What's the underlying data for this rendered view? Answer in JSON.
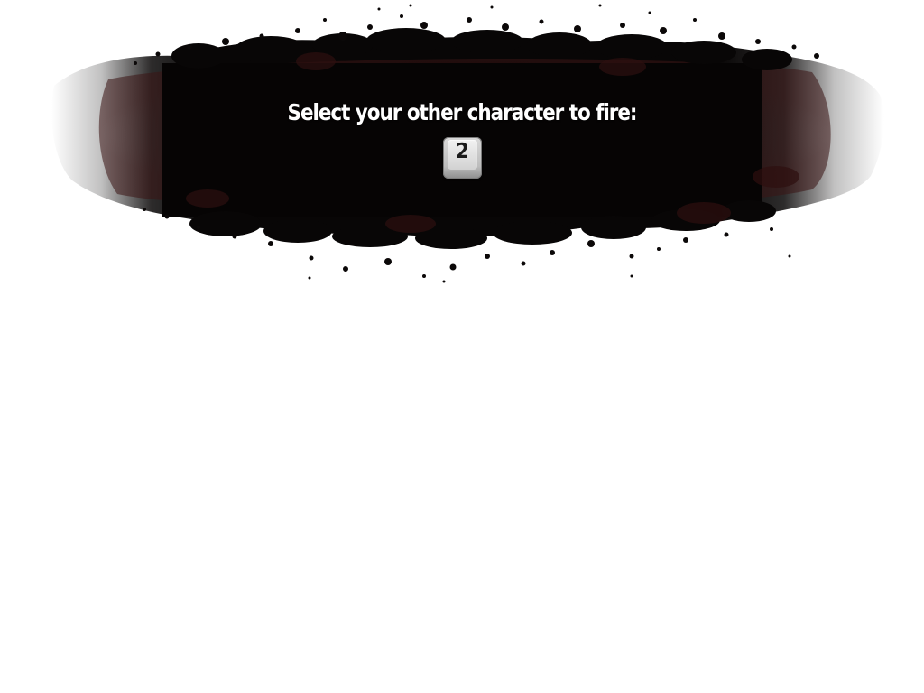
{
  "prompt": {
    "text": "Select your other character to fire:",
    "key_label": "2"
  },
  "colors": {
    "background": "#ffffff",
    "banner": "#080606",
    "banner_tint": "#3a1414",
    "text": "#ffffff"
  },
  "icons": {
    "key": "keyboard-key-icon"
  }
}
